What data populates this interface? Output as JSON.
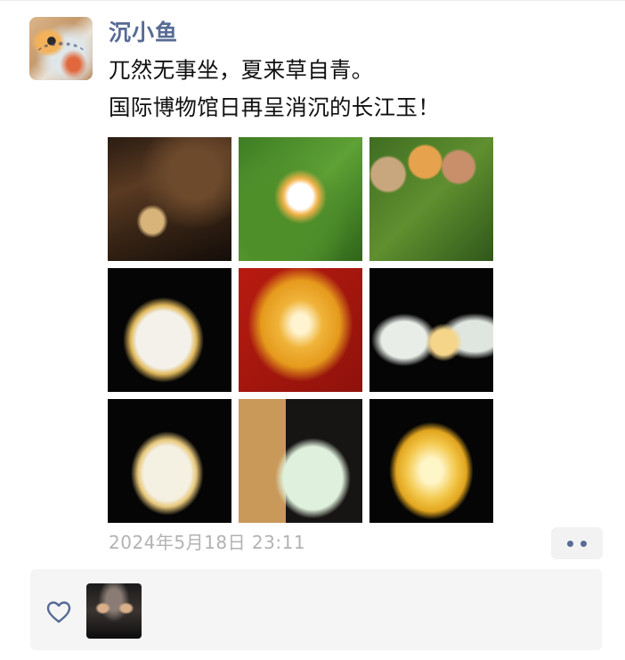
{
  "post": {
    "username": "沉小鱼",
    "text_line1": "兀然无事坐，夏来草自青。",
    "text_line2": "国际博物馆日再呈消沉的长江玉！",
    "timestamp": "2024年5月18日 23:11"
  },
  "images": [
    {
      "name": "carved-jade-figure-in-wood"
    },
    {
      "name": "jade-pebble-on-moss"
    },
    {
      "name": "jade-stones-and-rings-on-grass"
    },
    {
      "name": "white-carved-jade-piece"
    },
    {
      "name": "yellow-openwork-jade-carving"
    },
    {
      "name": "jade-bangles-stack"
    },
    {
      "name": "white-jade-bird-carving"
    },
    {
      "name": "green-jade-dragon-pendant"
    },
    {
      "name": "yellow-jade-pendant"
    }
  ],
  "actions": {
    "more_icon": "two-dots-icon",
    "like_icon": "heart-icon"
  },
  "colors": {
    "username": "#576b95",
    "timestamp": "#b2b2b2",
    "likes_background": "#f5f5f5"
  }
}
